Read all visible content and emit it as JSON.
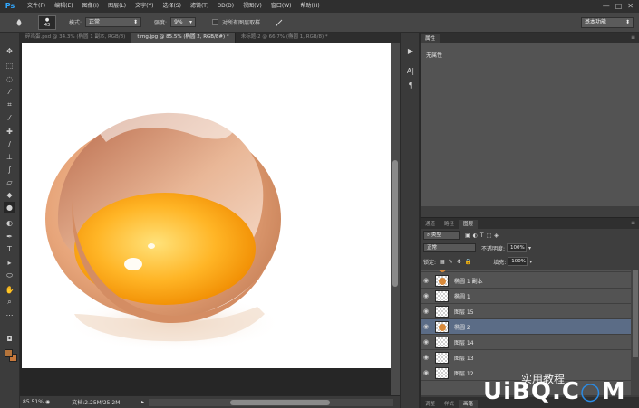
{
  "app": {
    "logo": "Ps"
  },
  "menu": [
    "文件(F)",
    "编辑(E)",
    "图像(I)",
    "图层(L)",
    "文字(Y)",
    "选择(S)",
    "滤镜(T)",
    "3D(D)",
    "视图(V)",
    "窗口(W)",
    "帮助(H)"
  ],
  "window_controls": [
    "—",
    "□",
    "✕"
  ],
  "options_bar": {
    "brush_size": "43",
    "mode_label": "模式:",
    "mode_value": "正常",
    "strength_label": "强度:",
    "strength_value": "9%",
    "sample_all_label": "对所有图层取样",
    "workspace": "基本功能"
  },
  "doc_tabs": [
    {
      "label": "碎鸡蛋.psd @ 34.3% (椭圆 1 副本, RGB/8)",
      "active": false
    },
    {
      "label": "timg.jpg @ 85.5% (椭圆 2, RGB/8#) *",
      "active": true
    },
    {
      "label": "未标题-2 @ 66.7% (椭圆 1, RGB/8) *",
      "active": false
    }
  ],
  "status": {
    "zoom": "85.51%",
    "doc_info": "文档:2.25M/25.2M"
  },
  "properties": {
    "tab": "属性",
    "body": "无属性"
  },
  "layers_panel": {
    "tabs": [
      "通道",
      "路径",
      "图层"
    ],
    "filter_kind": "类型",
    "blend_mode": "正常",
    "opacity_label": "不透明度:",
    "opacity_value": "100%",
    "lock_label": "锁定:",
    "fill_label": "填充:",
    "fill_value": "100%",
    "layers": [
      {
        "name": "椭圆 1 副本",
        "egg": true,
        "selected": false
      },
      {
        "name": "椭圆 1",
        "egg": false,
        "selected": false
      },
      {
        "name": "图层 15",
        "egg": false,
        "selected": false
      },
      {
        "name": "椭圆 2",
        "egg": true,
        "selected": true
      },
      {
        "name": "图层 14",
        "egg": false,
        "selected": false
      },
      {
        "name": "图层 13",
        "egg": false,
        "selected": false
      },
      {
        "name": "图层 12",
        "egg": false,
        "selected": false
      }
    ],
    "bottom_tabs": [
      "调整",
      "样式",
      "画笔"
    ]
  },
  "watermark": {
    "sub": "实用教程",
    "main_prefix": "UiBQ.C",
    "main_suffix": "M"
  },
  "colors": {
    "foreground": "#b5743b",
    "background": "#c8793c",
    "accent": "#31a8ff"
  }
}
